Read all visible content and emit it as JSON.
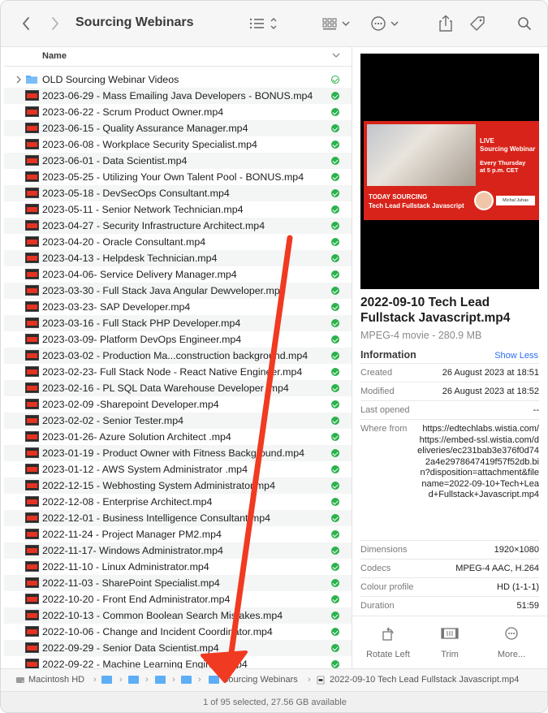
{
  "window": {
    "title": "Sourcing Webinars"
  },
  "list": {
    "column_name": "Name",
    "rows": [
      {
        "label": "OLD Sourcing Webinar Videos",
        "type": "folder",
        "status": "outline"
      },
      {
        "label": "2023-06-29 - Mass Emailing Java Developers - BONUS.mp4",
        "type": "video",
        "status": "synced"
      },
      {
        "label": "2023-06-22 - Scrum Product Owner.mp4",
        "type": "video",
        "status": "synced"
      },
      {
        "label": "2023-06-15 - Quality Assurance Manager.mp4",
        "type": "video",
        "status": "synced"
      },
      {
        "label": "2023-06-08 - Workplace Security Specialist.mp4",
        "type": "video",
        "status": "synced"
      },
      {
        "label": "2023-06-01 - Data Scientist.mp4",
        "type": "video",
        "status": "synced"
      },
      {
        "label": "2023-05-25 - Utilizing Your Own Talent Pool - BONUS.mp4",
        "type": "video",
        "status": "synced"
      },
      {
        "label": "2023-05-18 - DevSecOps Consultant.mp4",
        "type": "video",
        "status": "synced"
      },
      {
        "label": "2023-05-11 - Senior Network Technician.mp4",
        "type": "video",
        "status": "synced"
      },
      {
        "label": "2023-04-27 - Security Infrastructure Architect.mp4",
        "type": "video",
        "status": "synced"
      },
      {
        "label": "2023-04-20 - Oracle Consultant.mp4",
        "type": "video",
        "status": "synced"
      },
      {
        "label": "2023-04-13 - Helpdesk Technician.mp4",
        "type": "video",
        "status": "synced"
      },
      {
        "label": "2023-04-06- Service Delivery Manager.mp4",
        "type": "video",
        "status": "synced"
      },
      {
        "label": "2023-03-30 - Full Stack Java Angular Dewveloper.mp4",
        "type": "video",
        "status": "synced"
      },
      {
        "label": "2023-03-23- SAP Developer.mp4",
        "type": "video",
        "status": "synced"
      },
      {
        "label": "2023-03-16 - Full Stack PHP Developer.mp4",
        "type": "video",
        "status": "synced"
      },
      {
        "label": "2023-03-09- Platform DevOps Engineer.mp4",
        "type": "video",
        "status": "synced"
      },
      {
        "label": "2023-03-02 - Production Ma...construction background.mp4",
        "type": "video",
        "status": "synced"
      },
      {
        "label": "2023-02-23- Full Stack Node - React Native Engineer.mp4",
        "type": "video",
        "status": "synced"
      },
      {
        "label": "2023-02-16 - PL SQL Data Warehouse Developer .mp4",
        "type": "video",
        "status": "synced"
      },
      {
        "label": "2023-02-09 -Sharepoint Developer.mp4",
        "type": "video",
        "status": "synced"
      },
      {
        "label": "2023-02-02 - Senior Tester.mp4",
        "type": "video",
        "status": "synced"
      },
      {
        "label": "2023-01-26- Azure Solution Architect .mp4",
        "type": "video",
        "status": "synced"
      },
      {
        "label": "2023-01-19 - Product Owner with Fitness Background.mp4",
        "type": "video",
        "status": "synced"
      },
      {
        "label": "2023-01-12 - AWS System Administrator .mp4",
        "type": "video",
        "status": "synced"
      },
      {
        "label": "2022-12-15 - Webhosting System Administrator.mp4",
        "type": "video",
        "status": "synced"
      },
      {
        "label": "2022-12-08 - Enterprise Architect.mp4",
        "type": "video",
        "status": "synced"
      },
      {
        "label": "2022-12-01 -  Business Intelligence Consultant.mp4",
        "type": "video",
        "status": "synced"
      },
      {
        "label": "2022-11-24 - Project Manager PM2.mp4",
        "type": "video",
        "status": "synced"
      },
      {
        "label": "2022-11-17- Windows Administrator.mp4",
        "type": "video",
        "status": "synced"
      },
      {
        "label": "2022-11-10 - Linux Administrator.mp4",
        "type": "video",
        "status": "synced"
      },
      {
        "label": "2022-11-03 - SharePoint Specialist.mp4",
        "type": "video",
        "status": "synced"
      },
      {
        "label": "2022-10-20 - Front End Administrator.mp4",
        "type": "video",
        "status": "synced"
      },
      {
        "label": "2022-10-13 - Common Boolean Search Mistakes.mp4",
        "type": "video",
        "status": "synced"
      },
      {
        "label": "2022-10-06 - Change and Incident Coordinator.mp4",
        "type": "video",
        "status": "synced"
      },
      {
        "label": "2022-09-29 - Senior Data Scientist.mp4",
        "type": "video",
        "status": "synced"
      },
      {
        "label": "2022-09-22 - Machine Learning Engineer.mp4",
        "type": "video",
        "status": "synced"
      }
    ]
  },
  "preview": {
    "thumb": {
      "live": "LIVE",
      "webinar": "Sourcing Webinar",
      "every": "Every Thursday",
      "time": "at 5 p.m. CET",
      "today": "TODAY SOURCING",
      "topic": "Tech Lead Fullstack Javascript",
      "presenter": "Michal Juhas"
    },
    "file_title": "2022-09-10 Tech Lead Fullstack Javascript.mp4",
    "subtitle": "MPEG-4 movie - 280.9 MB",
    "info_heading": "Information",
    "show_less": "Show Less",
    "info": {
      "created_k": "Created",
      "created_v": "26 August 2023 at 18:51",
      "modified_k": "Modified",
      "modified_v": "26 August 2023 at 18:52",
      "opened_k": "Last opened",
      "opened_v": "--",
      "where_k": "Where from",
      "where_v": "https://edtechlabs.wistia.com/ https://embed-ssl.wistia.com/deliveries/ec231bab3e376f0d742a4e2978647419f57f52db.bin?disposition=attachment&filename=2022-09-10+Tech+Lead+Fullstack+Javascript.mp4",
      "dim_k": "Dimensions",
      "dim_v": "1920×1080",
      "codecs_k": "Codecs",
      "codecs_v": "MPEG-4 AAC, H.264",
      "colour_k": "Colour profile",
      "colour_v": "HD (1-1-1)",
      "dur_k": "Duration",
      "dur_v": "51:59"
    },
    "actions": {
      "rotate": "Rotate Left",
      "trim": "Trim",
      "more": "More..."
    }
  },
  "pathbar": {
    "disk": "Macintosh HD",
    "folder": "Sourcing Webinars",
    "file": "2022-09-10 Tech Lead Fullstack Javascript.mp4"
  },
  "status": {
    "text": "1 of 95 selected, 27.56 GB available"
  },
  "colors": {
    "accent": "#2a6df4",
    "synced": "#2bb24c",
    "annotation_arrow": "#f03a21"
  }
}
